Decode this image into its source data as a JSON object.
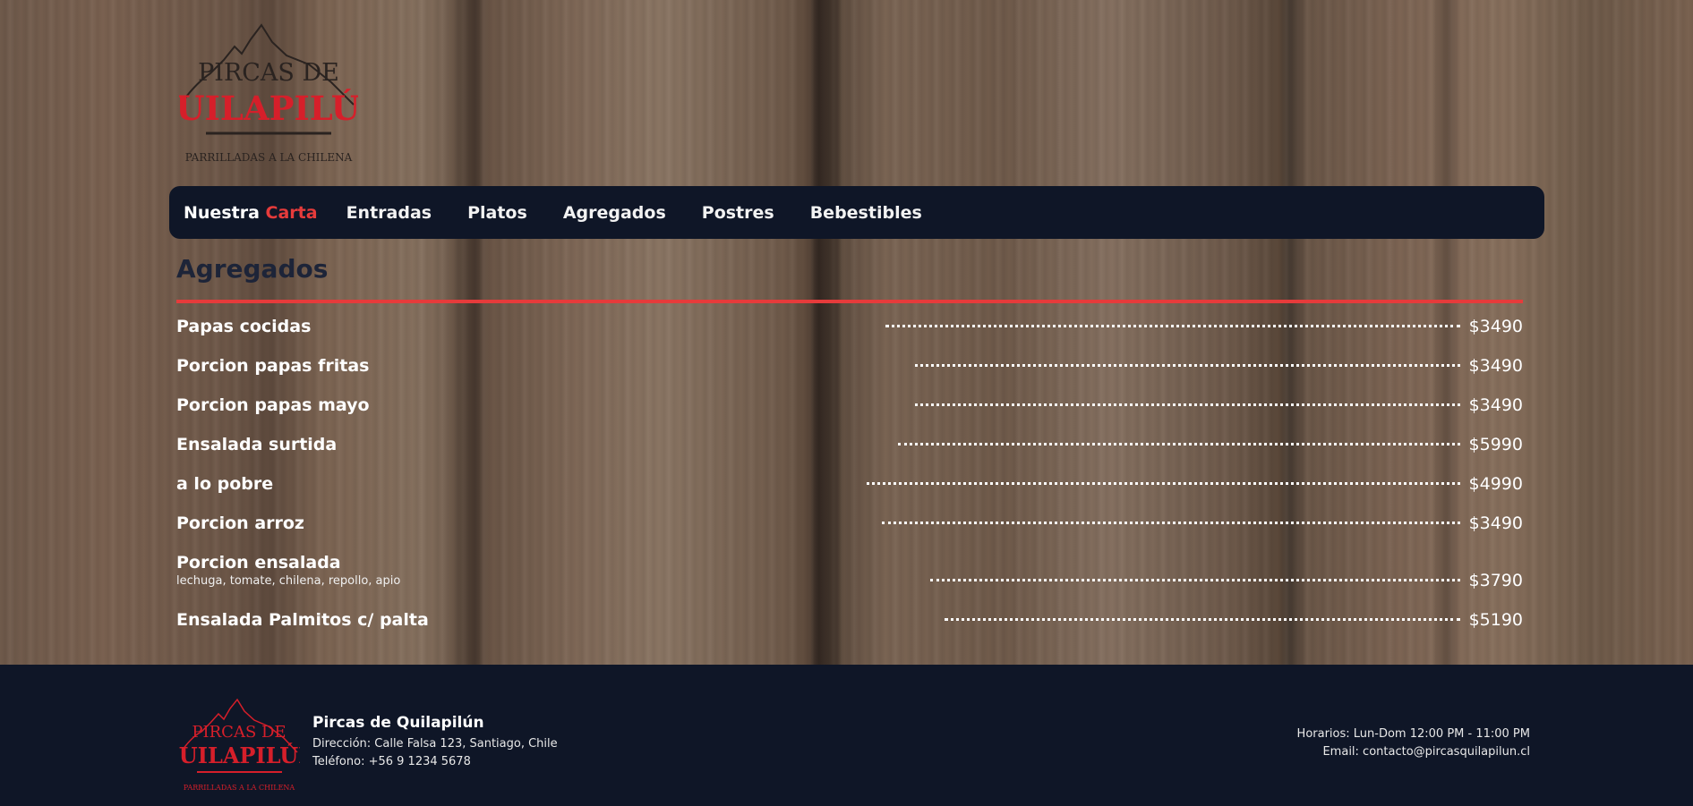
{
  "brand": {
    "logo_top": "PIRCAS DE",
    "logo_main": "QUILAPILÚN",
    "logo_tagline": "PARRILLADAS A LA CHILENA"
  },
  "nav": {
    "brand_prefix": "Nuestra",
    "brand_accent": "Carta",
    "links": [
      "Entradas",
      "Platos",
      "Agregados",
      "Postres",
      "Bebestibles"
    ]
  },
  "section": {
    "title": "Agregados",
    "items": [
      {
        "name": "Papas cocidas",
        "desc": "",
        "price": "$3490"
      },
      {
        "name": "Porcion papas fritas",
        "desc": "",
        "price": "$3490"
      },
      {
        "name": "Porcion papas mayo",
        "desc": "",
        "price": "$3490"
      },
      {
        "name": "Ensalada surtida",
        "desc": "",
        "price": "$5990"
      },
      {
        "name": "a lo pobre",
        "desc": "",
        "price": "$4990"
      },
      {
        "name": "Porcion arroz",
        "desc": "",
        "price": "$3490"
      },
      {
        "name": "Porcion ensalada",
        "desc": "lechuga, tomate, chilena, repollo, apio",
        "price": "$3790"
      },
      {
        "name": "Ensalada Palmitos c/ palta",
        "desc": "",
        "price": "$5190"
      }
    ]
  },
  "footer": {
    "name": "Pircas de Quilapilún",
    "address": "Dirección: Calle Falsa 123, Santiago, Chile",
    "phone": "Teléfono: +56 9 1234 5678",
    "hours": "Horarios: Lun-Dom 12:00 PM - 11:00 PM",
    "email": "Email: contacto@pircasquilapilun.cl"
  },
  "colors": {
    "accent": "#e63b3b",
    "navy": "#0f1627"
  }
}
